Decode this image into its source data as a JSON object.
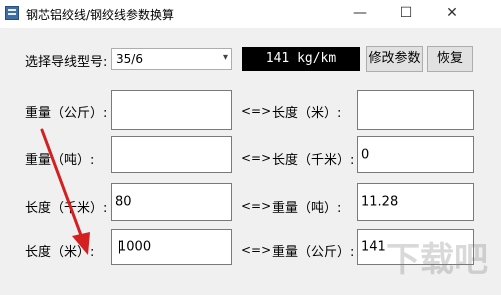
{
  "window": {
    "title": "钢芯铝绞线/钢绞线参数换算",
    "controls": {
      "minimize": "—",
      "maximize": "☐",
      "close": "✕"
    }
  },
  "top": {
    "select_label": "选择导线型号:",
    "selected_model": "35/6",
    "display_value": "141 kg/km",
    "modify_button": "修改参数",
    "restore_button": "恢复"
  },
  "rows": [
    {
      "left_label": "重量（公斤）:",
      "left_value": "",
      "arrow": "<=>",
      "right_label": "长度（米）:",
      "right_value": ""
    },
    {
      "left_label": "重量（吨）:",
      "left_value": "",
      "arrow": "<=>",
      "right_label": "长度（千米）:",
      "right_value": "0"
    },
    {
      "left_label": "长度（千米）:",
      "left_value": "80",
      "arrow": "<=>",
      "right_label": "重量（吨）:",
      "right_value": "11.28"
    },
    {
      "left_label": "长度（米）:",
      "left_value": "1000",
      "arrow": "<=>",
      "right_label": "重量（公斤）:",
      "right_value": "141"
    }
  ],
  "watermark": "下载吧",
  "colors": {
    "display_bg": "#000000",
    "display_fg": "#ffffff",
    "annotation_arrow": "#d42020"
  }
}
